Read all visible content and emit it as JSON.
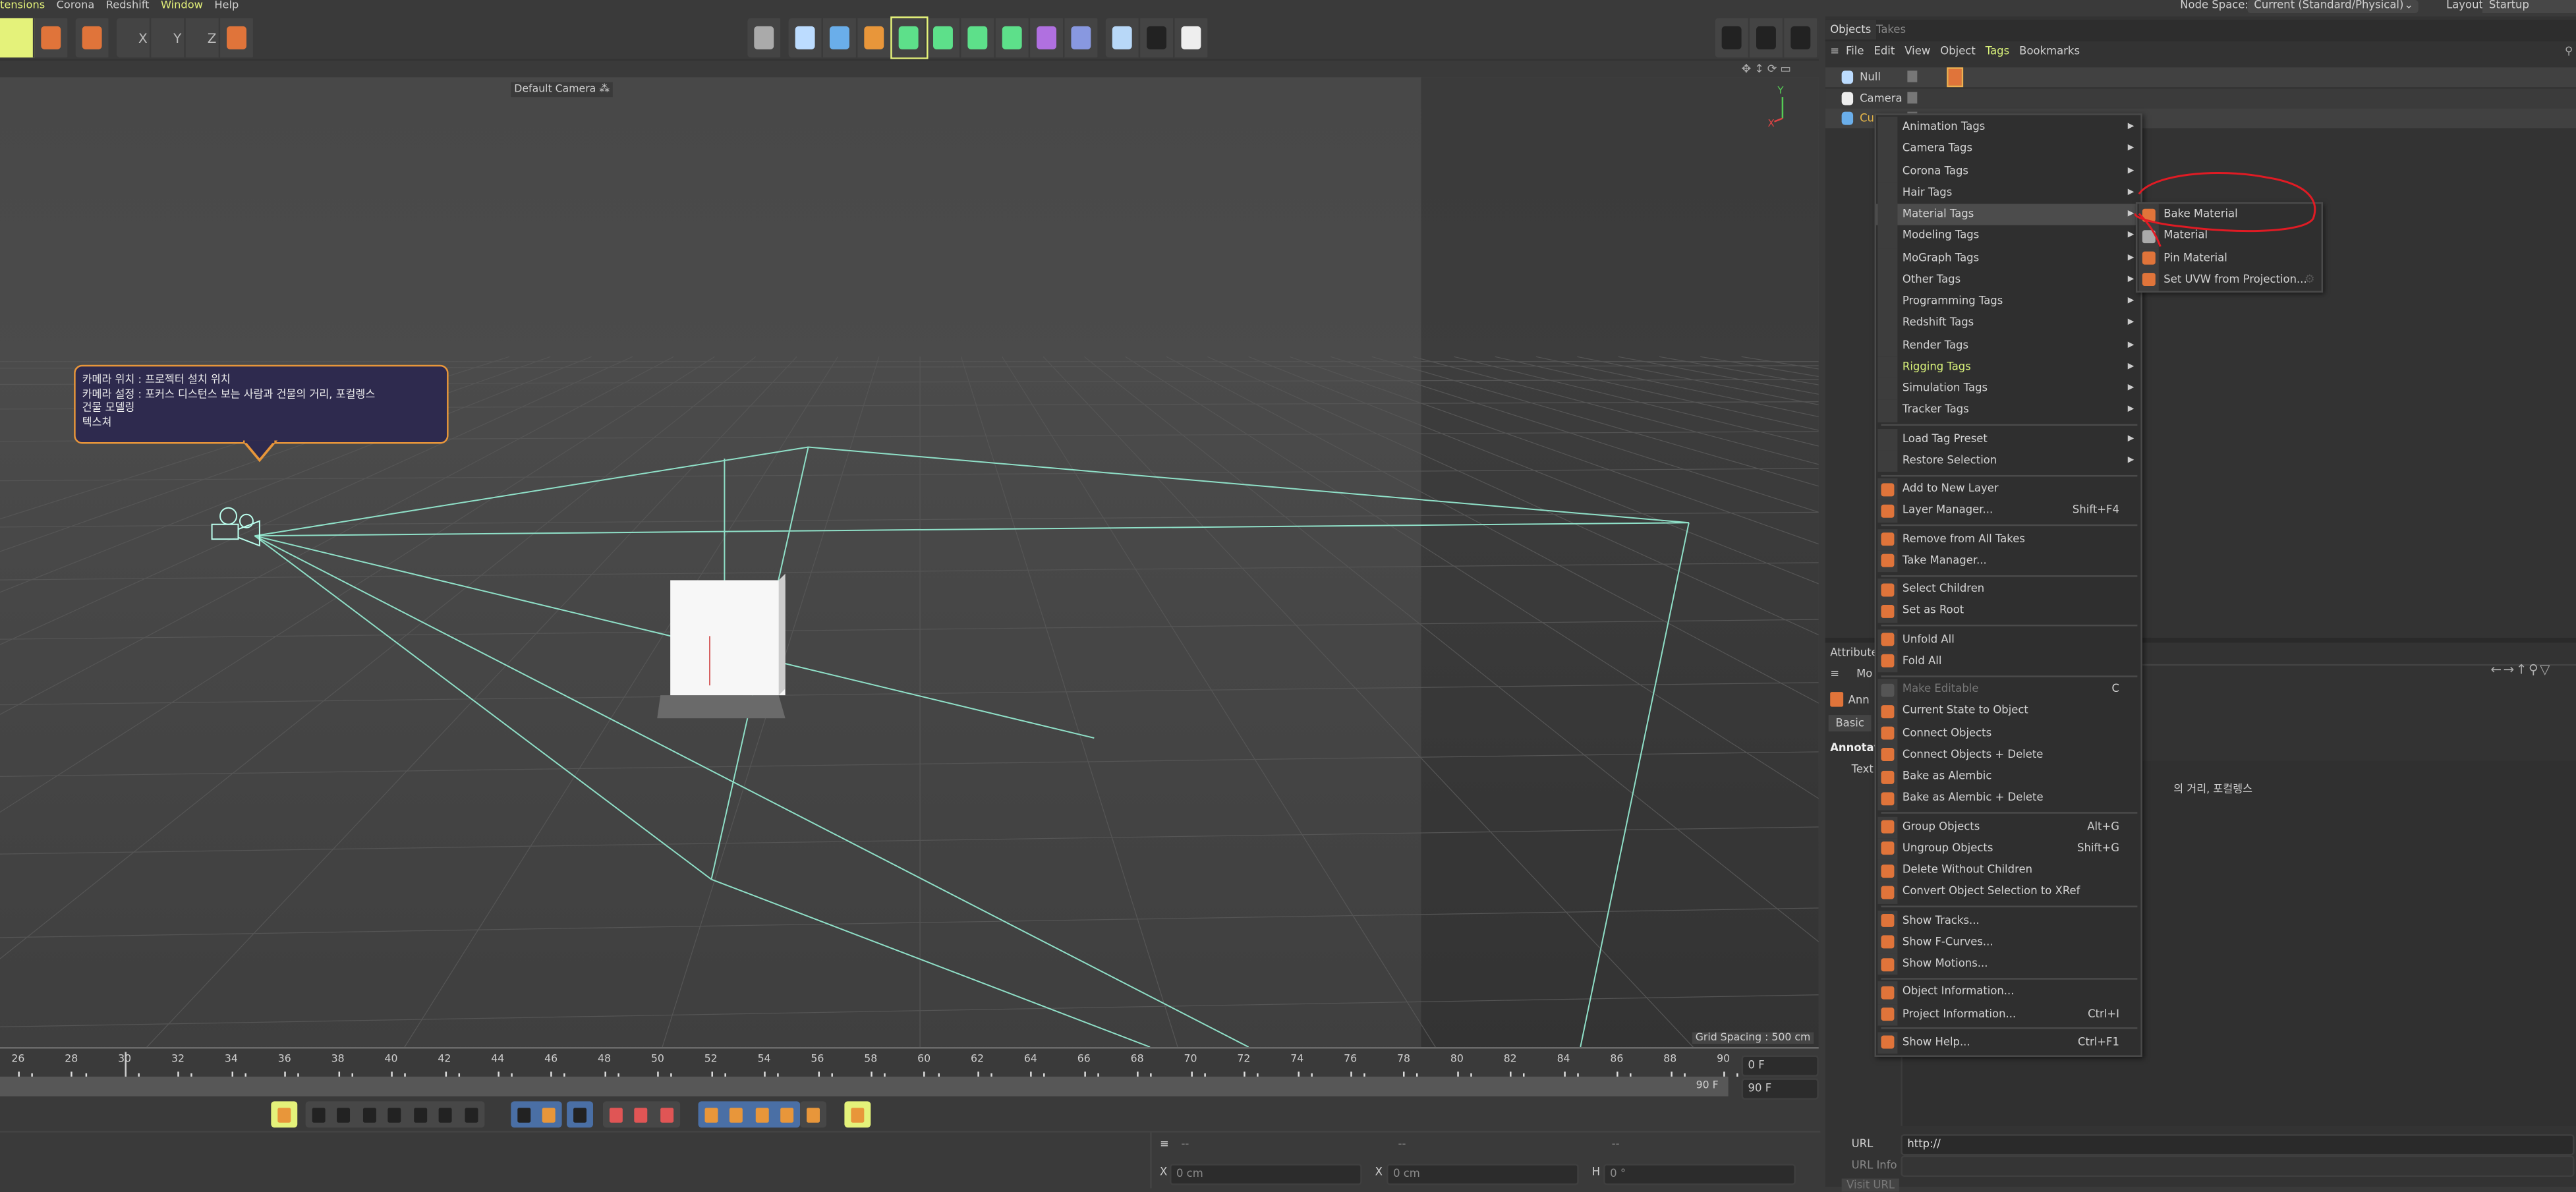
{
  "menubar": {
    "items": [
      "tensions",
      "Corona",
      "Redshift",
      "Window",
      "Help"
    ],
    "active": "Window"
  },
  "top_right": {
    "node_space_label": "Node Space:",
    "node_space_value": "Current (Standard/Physical)",
    "layout_label": "Layout:",
    "layout_value": "Startup"
  },
  "toolbar": {
    "left_icons": [
      "move-tool-icon",
      "scale-rotate-icon",
      "move-axis-icon",
      "x-axis-lock-icon",
      "y-axis-lock-icon",
      "z-axis-lock-icon",
      "coordinate-system-icon"
    ],
    "axis_labels": [
      "X",
      "Y",
      "Z"
    ],
    "center_icons": [
      "render-region-icon",
      "null-object-icon",
      "cube-icon",
      "pen-spline-icon",
      "subdivision-surface-icon",
      "extrude-icon",
      "cloner-icon",
      "mograph-fracture-icon",
      "symmetry-icon",
      "deformer-icon",
      "floor-icon",
      "camera-icon",
      "light-icon"
    ],
    "right_icons": [
      "render-view-icon",
      "render-picture-viewer-icon",
      "render-settings-icon"
    ]
  },
  "viewport": {
    "camera_label": "Default Camera",
    "grid_spacing": "Grid Spacing : 500 cm",
    "axis_labels": [
      "Y",
      "X",
      "Z"
    ],
    "annotation_lines": [
      "카메라 위치 : 프로젝터 설치 위치",
      "카메라 설정 : 포커스 디스턴스 보는 사람과 건물의 거리, 포컬렝스",
      "건물 모델링",
      "텍스쳐"
    ],
    "colors": {
      "frustum": "#8fe0c8",
      "annotation_bg": "#2e2a4e",
      "annotation_border": "#e8963a"
    }
  },
  "timeline": {
    "start": 26,
    "end": 90,
    "step": 2,
    "current_frame_marker": 30,
    "current_frame": "0 F",
    "end_frame_label": "90 F",
    "end_frame_field": "90 F"
  },
  "coordinates": {
    "headers": [
      "--",
      "--",
      "--"
    ],
    "fields": [
      {
        "axis": "X",
        "value": "0 cm"
      },
      {
        "axis": "X",
        "value": "0 cm"
      },
      {
        "axis": "H",
        "value": "0 °"
      }
    ]
  },
  "objects_panel": {
    "tabs": [
      "Objects",
      "Takes"
    ],
    "menu": [
      "File",
      "Edit",
      "View",
      "Object",
      "Tags",
      "Bookmarks"
    ],
    "active_menu": "Tags",
    "rows": [
      {
        "name": "Null"
      },
      {
        "name": "Camera"
      },
      {
        "name": "Cu"
      }
    ]
  },
  "context_menu": {
    "groups": [
      [
        {
          "label": "Animation Tags",
          "submenu": true
        },
        {
          "label": "Camera Tags",
          "submenu": true
        },
        {
          "label": "Corona Tags",
          "submenu": true
        },
        {
          "label": "Hair Tags",
          "submenu": true
        },
        {
          "label": "Material Tags",
          "submenu": true,
          "highlighted": true
        },
        {
          "label": "Modeling Tags",
          "submenu": true
        },
        {
          "label": "MoGraph Tags",
          "submenu": true
        },
        {
          "label": "Other Tags",
          "submenu": true
        },
        {
          "label": "Programming Tags",
          "submenu": true
        },
        {
          "label": "Redshift Tags",
          "submenu": true
        },
        {
          "label": "Render Tags",
          "submenu": true
        },
        {
          "label": "Rigging Tags",
          "submenu": true,
          "accent": true
        },
        {
          "label": "Simulation Tags",
          "submenu": true
        },
        {
          "label": "Tracker Tags",
          "submenu": true
        }
      ],
      [
        {
          "label": "Load Tag Preset",
          "submenu": true
        },
        {
          "label": "Restore Selection",
          "submenu": true
        }
      ],
      [
        {
          "label": "Add to New Layer",
          "icon": "add-layer-icon"
        },
        {
          "label": "Layer Manager...",
          "shortcut": "Shift+F4",
          "icon": "layer-manager-icon"
        }
      ],
      [
        {
          "label": "Remove from All Takes",
          "icon": "remove-takes-icon"
        },
        {
          "label": "Take Manager...",
          "icon": "take-manager-icon"
        }
      ],
      [
        {
          "label": "Select Children",
          "icon": "select-children-icon"
        },
        {
          "label": "Set as Root",
          "icon": "set-root-icon"
        }
      ],
      [
        {
          "label": "Unfold All",
          "icon": "unfold-icon"
        },
        {
          "label": "Fold All",
          "icon": "fold-icon"
        }
      ],
      [
        {
          "label": "Make Editable",
          "shortcut": "C",
          "disabled": true,
          "icon": "make-editable-icon"
        },
        {
          "label": "Current State to Object",
          "icon": "current-state-icon"
        },
        {
          "label": "Connect Objects",
          "icon": "connect-icon"
        },
        {
          "label": "Connect Objects + Delete",
          "icon": "connect-delete-icon"
        },
        {
          "label": "Bake as Alembic",
          "icon": "alembic-icon"
        },
        {
          "label": "Bake as Alembic + Delete",
          "icon": "alembic-delete-icon"
        }
      ],
      [
        {
          "label": "Group Objects",
          "shortcut": "Alt+G",
          "icon": "group-icon"
        },
        {
          "label": "Ungroup Objects",
          "shortcut": "Shift+G",
          "icon": "ungroup-icon"
        },
        {
          "label": "Delete Without Children",
          "icon": "delete-icon"
        },
        {
          "label": "Convert Object Selection to XRef",
          "icon": "xref-icon"
        }
      ],
      [
        {
          "label": "Show Tracks...",
          "icon": "tracks-icon"
        },
        {
          "label": "Show F-Curves...",
          "icon": "fcurves-icon"
        },
        {
          "label": "Show Motions...",
          "icon": "motions-icon"
        }
      ],
      [
        {
          "label": "Object Information...",
          "icon": "object-info-icon"
        },
        {
          "label": "Project Information...",
          "shortcut": "Ctrl+I",
          "icon": "project-info-icon"
        }
      ],
      [
        {
          "label": "Show Help...",
          "shortcut": "Ctrl+F1",
          "icon": "help-icon"
        }
      ]
    ],
    "submenu": [
      {
        "label": "Bake Material",
        "icon": "bake-material-icon"
      },
      {
        "label": "Material",
        "icon": "material-icon"
      },
      {
        "label": "Pin Material",
        "icon": "pin-material-icon"
      },
      {
        "label": "Set UVW from Projection...",
        "icon": "uvw-icon",
        "gear": true
      }
    ],
    "colors": {
      "highlight": "#4c4c4c",
      "accent": "#d9f27a",
      "icon": "#e0743a",
      "markup": "#e01b24"
    }
  },
  "attributes": {
    "tab": "Attribute",
    "mode": "Mo",
    "object": "Ann",
    "basic_tab": "Basic",
    "section": "Annotat",
    "text_label": "Text",
    "text_value": "의 거리, 포컬렝스",
    "url_label": "URL",
    "url_value": "http://",
    "url_info_label": "URL Info",
    "visit_button": "Visit URL"
  }
}
